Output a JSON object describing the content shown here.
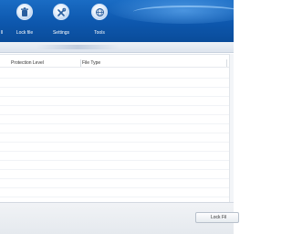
{
  "toolbar": {
    "items": [
      {
        "label": "ll",
        "icon": "partial-icon"
      },
      {
        "label": "Lock file",
        "icon": "trash-can-icon"
      },
      {
        "label": "Settings",
        "icon": "tools-icon"
      },
      {
        "label": "Tools",
        "icon": "globe-icon"
      }
    ]
  },
  "list": {
    "columns": [
      "Protection Level",
      "File Type"
    ]
  },
  "footer": {
    "action_label": "Lock Fil"
  },
  "colors": {
    "header_blue": "#0d57ad",
    "header_highlight": "#78beff"
  }
}
